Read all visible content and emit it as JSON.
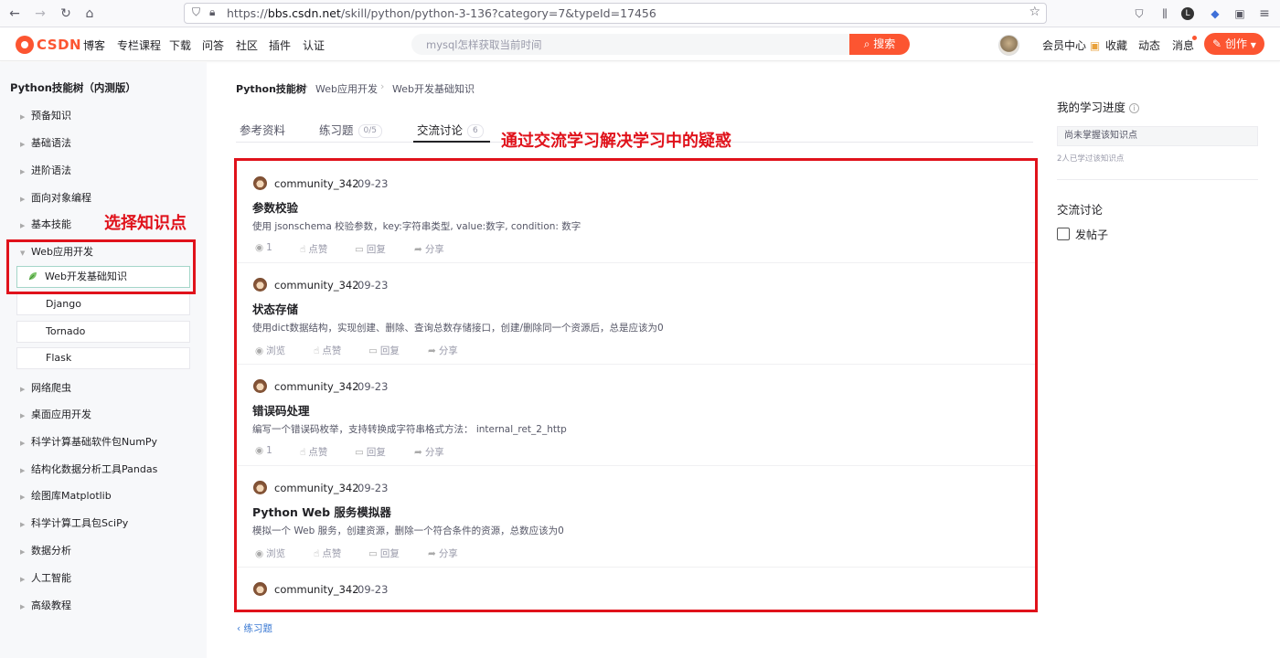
{
  "browser": {
    "url_scheme": "https://",
    "url_host": "bbs.csdn.net",
    "url_path": "/skill/python/python-3-136?category=7&typeId=17456"
  },
  "header": {
    "logo": "CSDN",
    "nav": [
      "博客",
      "专栏课程",
      "下载",
      "问答",
      "社区",
      "插件",
      "认证"
    ],
    "search_placeholder": "mysql怎样获取当前时间",
    "search_button": "搜索",
    "right_nav": [
      "会员中心",
      "收藏",
      "动态",
      "消息"
    ],
    "create_button": "创作",
    "accent_color": "#fc5531"
  },
  "sidebar": {
    "title": "Python技能树（内测版）",
    "items": [
      "预备知识",
      "基础语法",
      "进阶语法",
      "面向对象编程",
      "基本技能",
      "Web应用开发"
    ],
    "subitems": [
      "Web开发基础知识",
      "Django",
      "Tornado",
      "Flask"
    ],
    "items_after": [
      "网络爬虫",
      "桌面应用开发",
      "科学计算基础软件包NumPy",
      "结构化数据分析工具Pandas",
      "绘图库Matplotlib",
      "科学计算工具包SciPy",
      "数据分析",
      "人工智能",
      "高级教程"
    ]
  },
  "annotations": {
    "select_point": "选择知识点",
    "discussion_note": "通过交流学习解决学习中的疑惑",
    "color": "#e0121b"
  },
  "breadcrumb": [
    "Python技能树",
    "Web应用开发",
    "Web开发基础知识"
  ],
  "tabs": [
    {
      "label": "参考资料",
      "count": ""
    },
    {
      "label": "练习题",
      "count": "0/5"
    },
    {
      "label": "交流讨论",
      "count": "6"
    }
  ],
  "posts": [
    {
      "user": "community_342",
      "date": "09-23",
      "title": "参数校验",
      "desc": "使用 jsonschema 校验参数，key:字符串类型, value:数字, condition: 数字",
      "views": "1",
      "like": "点赞",
      "reply": "回复",
      "share": "分享"
    },
    {
      "user": "community_342",
      "date": "09-23",
      "title": "状态存储",
      "desc": "使用dict数据结构，实现创建、删除、查询总数存储接口，创建/删除同一个资源后，总是应该为0",
      "views": "浏览",
      "like": "点赞",
      "reply": "回复",
      "share": "分享"
    },
    {
      "user": "community_342",
      "date": "09-23",
      "title": "错误码处理",
      "desc": "编写一个错误码枚举，支持转换成字符串格式方法： internal_ret_2_http",
      "views": "1",
      "like": "点赞",
      "reply": "回复",
      "share": "分享"
    },
    {
      "user": "community_342",
      "date": "09-23",
      "title": "Python Web 服务模拟器",
      "desc": "模拟一个 Web 服务，创建资源，删除一个符合条件的资源，总数应该为0",
      "views": "浏览",
      "like": "点赞",
      "reply": "回复",
      "share": "分享"
    },
    {
      "user": "community_342",
      "date": "09-23",
      "title": "",
      "desc": "",
      "views": "",
      "like": "",
      "reply": "",
      "share": ""
    }
  ],
  "back_link": "练习题",
  "right_panel": {
    "progress_title": "我的学习进度",
    "progress_status": "尚未掌握该知识点",
    "progress_sub": "2人已学过该知识点",
    "discussion_title": "交流讨论",
    "post_button": "发帖子"
  }
}
